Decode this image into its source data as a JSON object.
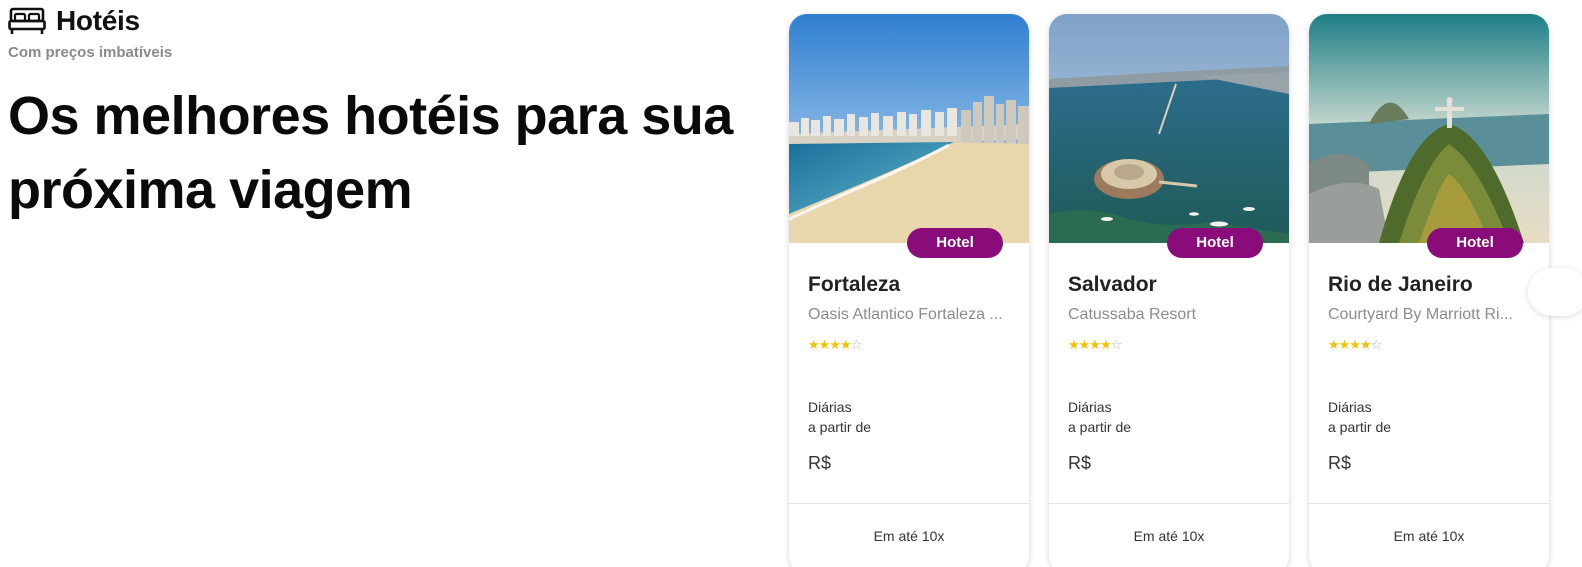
{
  "section": {
    "icon": "bed-icon",
    "title": "Hotéis",
    "subtitle": "Com preços imbatíveis",
    "headline_line1": "Os melhores hotéis para sua",
    "headline_line2": "próxima viagem"
  },
  "colors": {
    "badge": "#8a0c7a",
    "star": "#f2c200"
  },
  "cards": [
    {
      "badge": "Hotel",
      "city": "Fortaleza",
      "hotel": "Oasis Atlantico Fortaleza ...",
      "stars": 4,
      "daily_label": "Diárias",
      "from_label": "a partir de",
      "currency": "R$",
      "installments": "Em até 10x"
    },
    {
      "badge": "Hotel",
      "city": "Salvador",
      "hotel": "Catussaba Resort",
      "stars": 4,
      "daily_label": "Diárias",
      "from_label": "a partir de",
      "currency": "R$",
      "installments": "Em até 10x"
    },
    {
      "badge": "Hotel",
      "city": "Rio de Janeiro",
      "hotel": "Courtyard By Marriott Ri...",
      "stars": 4,
      "daily_label": "Diárias",
      "from_label": "a partir de",
      "currency": "R$",
      "installments": "Em até 10x"
    }
  ]
}
